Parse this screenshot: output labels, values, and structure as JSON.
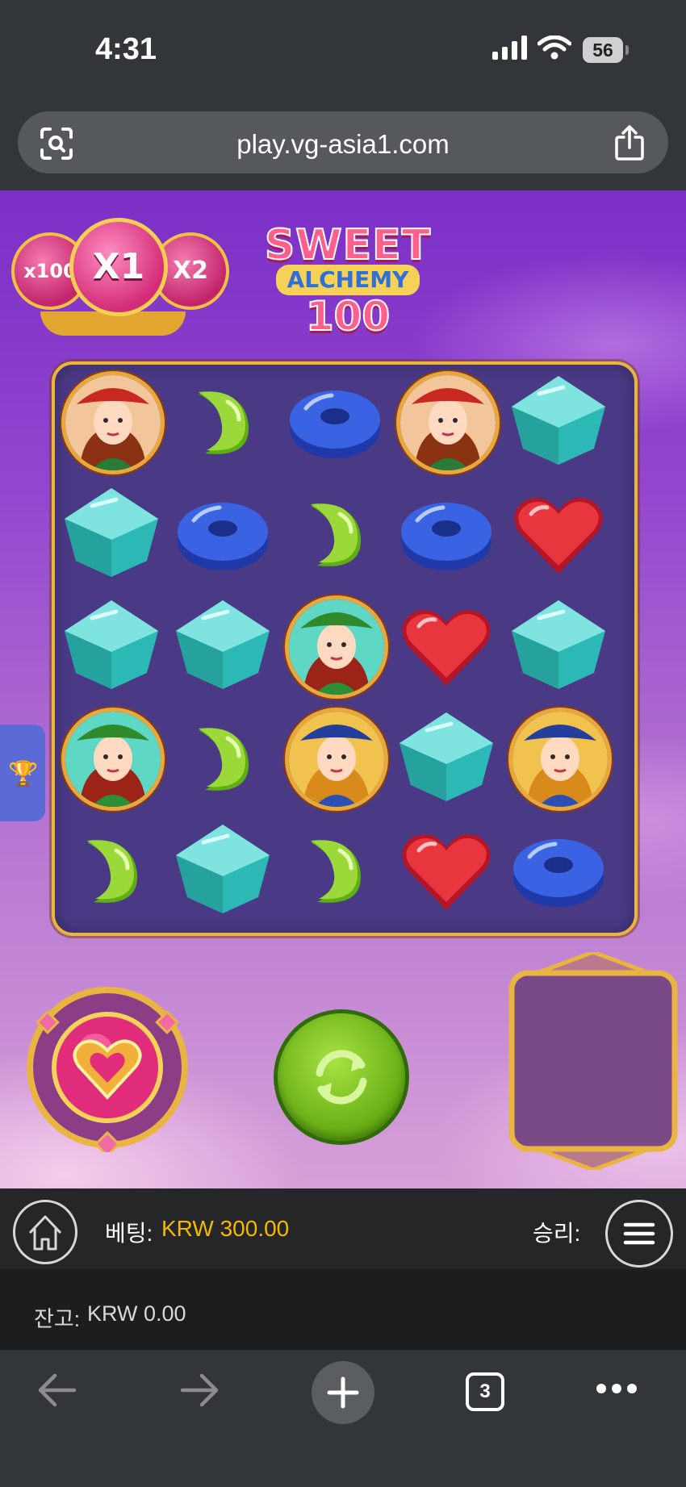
{
  "status_bar": {
    "time": "4:31",
    "battery": "56"
  },
  "browser": {
    "url": "play.vg-asia1.com",
    "tab_count": "3"
  },
  "game": {
    "multipliers": [
      "x100",
      "X1",
      "X2"
    ],
    "logo": {
      "line1": "SWEET",
      "line2": "ALCHEMY",
      "line3": "100"
    },
    "grid": [
      [
        "witch-red",
        "green-bean",
        "blue-ring",
        "witch-red",
        "teal-gem"
      ],
      [
        "teal-gem",
        "blue-ring",
        "green-bean",
        "blue-ring",
        "red-heart"
      ],
      [
        "teal-gem",
        "teal-gem",
        "witch-green",
        "red-heart",
        "teal-gem"
      ],
      [
        "witch-green",
        "green-bean",
        "witch-blue",
        "teal-gem",
        "witch-blue"
      ],
      [
        "green-bean",
        "teal-gem",
        "green-bean",
        "red-heart",
        "blue-ring"
      ]
    ]
  },
  "bottom_bar": {
    "bet_label": "베팅:",
    "bet_value": "KRW 300.00",
    "win_label": "승리:"
  },
  "balance_bar": {
    "balance_label": "잔고:",
    "balance_value": "KRW 0.00"
  },
  "colors": {
    "bet_accent": "#f4b800",
    "frame_gold": "#e9b540",
    "spin_green": "#7cc224"
  }
}
